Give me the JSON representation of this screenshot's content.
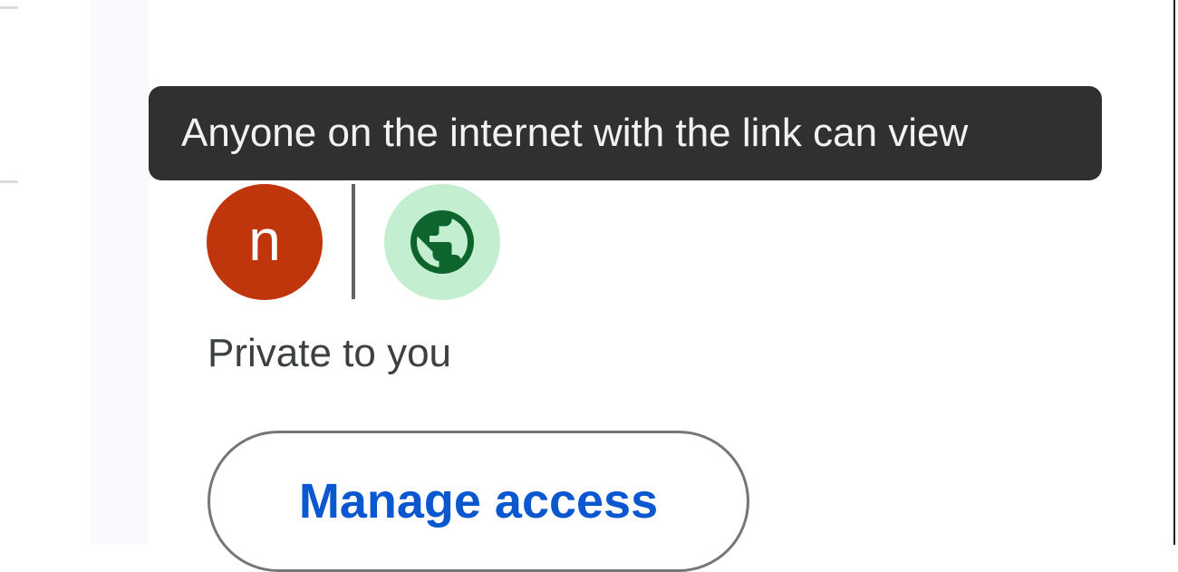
{
  "tooltip": {
    "text": "Anyone on the internet with the link can view"
  },
  "owner_avatar": {
    "initial": "n",
    "color": "#bf360c"
  },
  "link_access": {
    "icon": "globe-icon",
    "badge_color": "#c4eed0",
    "icon_color": "#0d652d"
  },
  "status": {
    "text": "Private to you"
  },
  "manage_button": {
    "label": "Manage access",
    "color": "#0b57d0"
  }
}
